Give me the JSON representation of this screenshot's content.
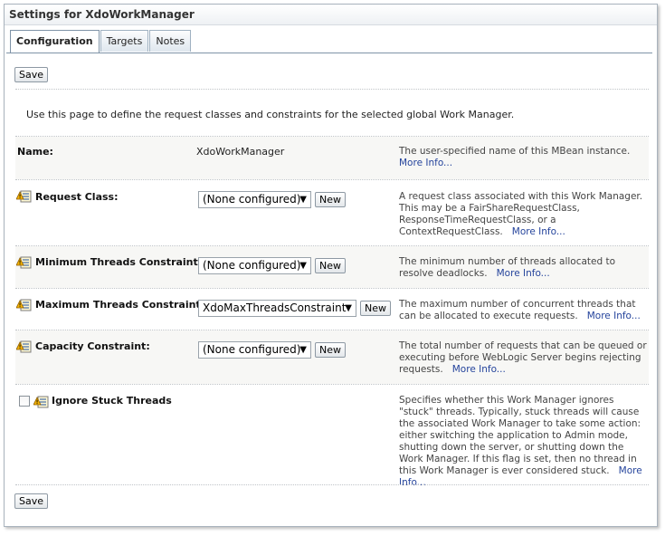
{
  "panel": {
    "title": "Settings for XdoWorkManager"
  },
  "tabs": [
    {
      "label": "Configuration"
    },
    {
      "label": "Targets"
    },
    {
      "label": "Notes"
    }
  ],
  "save_label": "Save",
  "intro": "Use this page to define the request classes and constraints for the selected global Work Manager.",
  "new_label": "New",
  "more_label": "More Info...",
  "rows": {
    "name": {
      "label": "Name:",
      "value": "XdoWorkManager",
      "desc": "The user-specified name of this MBean instance.",
      "more": "More Info..."
    },
    "request_class": {
      "label": "Request Class:",
      "value": "(None configured)",
      "desc": "A request class associated with this Work Manager. This may be a FairShareRequestClass, ResponseTimeRequestClass, or a ContextRequestClass."
    },
    "min_threads": {
      "label": "Minimum Threads Constraint:",
      "value": "(None configured)",
      "desc": "The minimum number of threads allocated to resolve deadlocks."
    },
    "max_threads": {
      "label": "Maximum Threads Constraint:",
      "value": "XdoMaxThreadsConstraint",
      "desc": "The maximum number of concurrent threads that can be allocated to execute requests."
    },
    "capacity": {
      "label": "Capacity Constraint:",
      "value": "(None configured)",
      "desc": "The total number of requests that can be queued or executing before WebLogic Server begins rejecting requests."
    },
    "ignore_stuck": {
      "label": "Ignore Stuck Threads",
      "checked": false,
      "desc": "Specifies whether this Work Manager ignores \"stuck\" threads. Typically, stuck threads will cause the associated Work Manager to take some action: either switching the application to Admin mode, shutting down the server, or shutting down the Work Manager. If this flag is set, then no thread in this Work Manager is ever considered stuck."
    }
  },
  "icons": {
    "change_notice": "restart-required-icon"
  }
}
